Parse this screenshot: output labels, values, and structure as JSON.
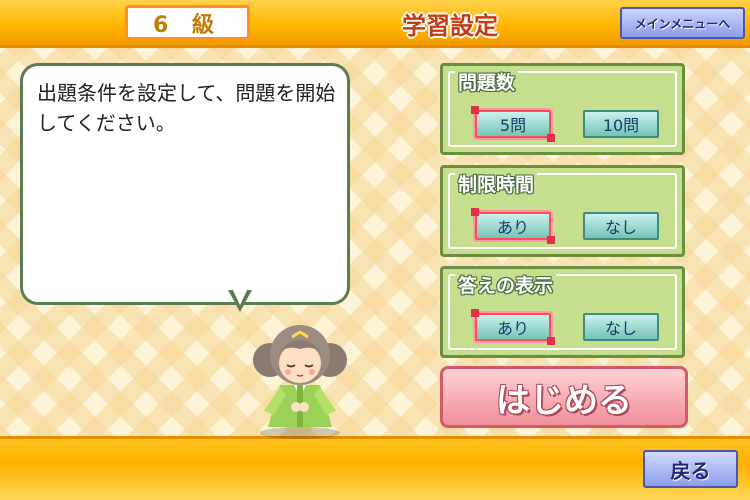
{
  "header": {
    "grade": "6 級",
    "title": "学習設定",
    "menu_button": "メインメニューへ"
  },
  "message": "出題条件を設定して、問題を開始してください。",
  "panels": [
    {
      "title": "問題数",
      "options": [
        "5問",
        "10問"
      ],
      "selected": "5問"
    },
    {
      "title": "制限時間",
      "options": [
        "あり",
        "なし"
      ],
      "selected": "あり"
    },
    {
      "title": "答えの表示",
      "options": [
        "あり",
        "なし"
      ],
      "selected": "あり"
    }
  ],
  "start_button": "はじめる",
  "back_button": "戻る",
  "colors": {
    "bar_orange": "#ffb700",
    "panel_green": "#c6df8f",
    "option_teal": "#74c3b6",
    "selected_red": "#e0304a",
    "start_pink": "#ef8f99",
    "nav_blue": "#8c9ee8"
  }
}
